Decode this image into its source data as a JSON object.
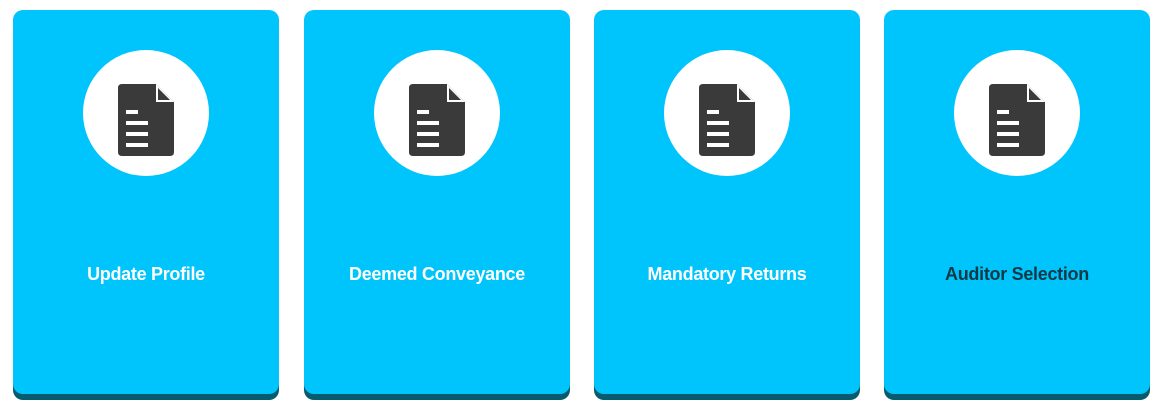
{
  "cards": [
    {
      "label": "Update Profile",
      "icon": "document-icon",
      "label_style": "light"
    },
    {
      "label": "Deemed Conveyance",
      "icon": "document-icon",
      "label_style": "light"
    },
    {
      "label": "Mandatory Returns",
      "icon": "document-icon",
      "label_style": "light"
    },
    {
      "label": "Auditor Selection",
      "icon": "document-icon",
      "label_style": "dark"
    }
  ],
  "colors": {
    "card_background": "#00c4fc",
    "card_shadow": "#075b6e",
    "icon_circle": "#ffffff",
    "icon": "#3a3a3a"
  }
}
